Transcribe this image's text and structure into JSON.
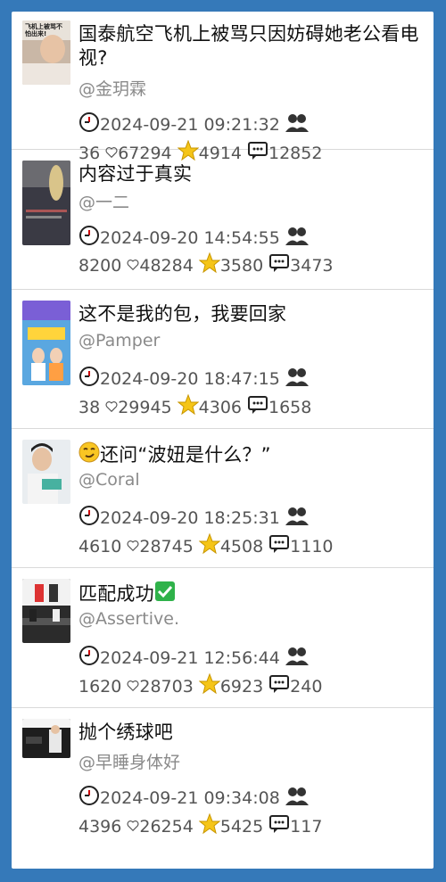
{
  "posts": [
    {
      "title": "国泰航空飞机上被骂只因妨碍她老公看电视?",
      "author": "@金玥霖",
      "time": "2024-09-21 09:21:32",
      "shares": "36",
      "likes": "67294",
      "stars": "4914",
      "comments": "12852",
      "thumb_text": "飞机上被骂不怕出来!"
    },
    {
      "title": "内容过于真实",
      "author": "@一二",
      "time": "2024-09-20 14:54:55",
      "shares": "8200",
      "likes": "48284",
      "stars": "3580",
      "comments": "3473"
    },
    {
      "title": "这不是我的包，我要回家",
      "author": "@Pamper",
      "time": "2024-09-20 18:47:15",
      "shares": "38",
      "likes": "29945",
      "stars": "4306",
      "comments": "1658"
    },
    {
      "title": "还问“波妞是什么？”",
      "author": "@Coral",
      "time": "2024-09-20 18:25:31",
      "shares": "4610",
      "likes": "28745",
      "stars": "4508",
      "comments": "1110"
    },
    {
      "title": "匹配成功",
      "author": "@Assertive.",
      "time": "2024-09-21 12:56:44",
      "shares": "1620",
      "likes": "28703",
      "stars": "6923",
      "comments": "240"
    },
    {
      "title": "抛个绣球吧",
      "author": "@早睡身体好",
      "time": "2024-09-21 09:34:08",
      "shares": "4396",
      "likes": "26254",
      "stars": "5425",
      "comments": "117"
    }
  ],
  "colors": {
    "background": "#3579b9",
    "star": "#f5c518",
    "text_meta": "#555555",
    "author": "#8a8a8a"
  },
  "icons": [
    "clock-icon",
    "users-icon",
    "heart-icon",
    "star-icon",
    "comment-icon",
    "smirk-emoji-icon",
    "check-box-icon"
  ]
}
